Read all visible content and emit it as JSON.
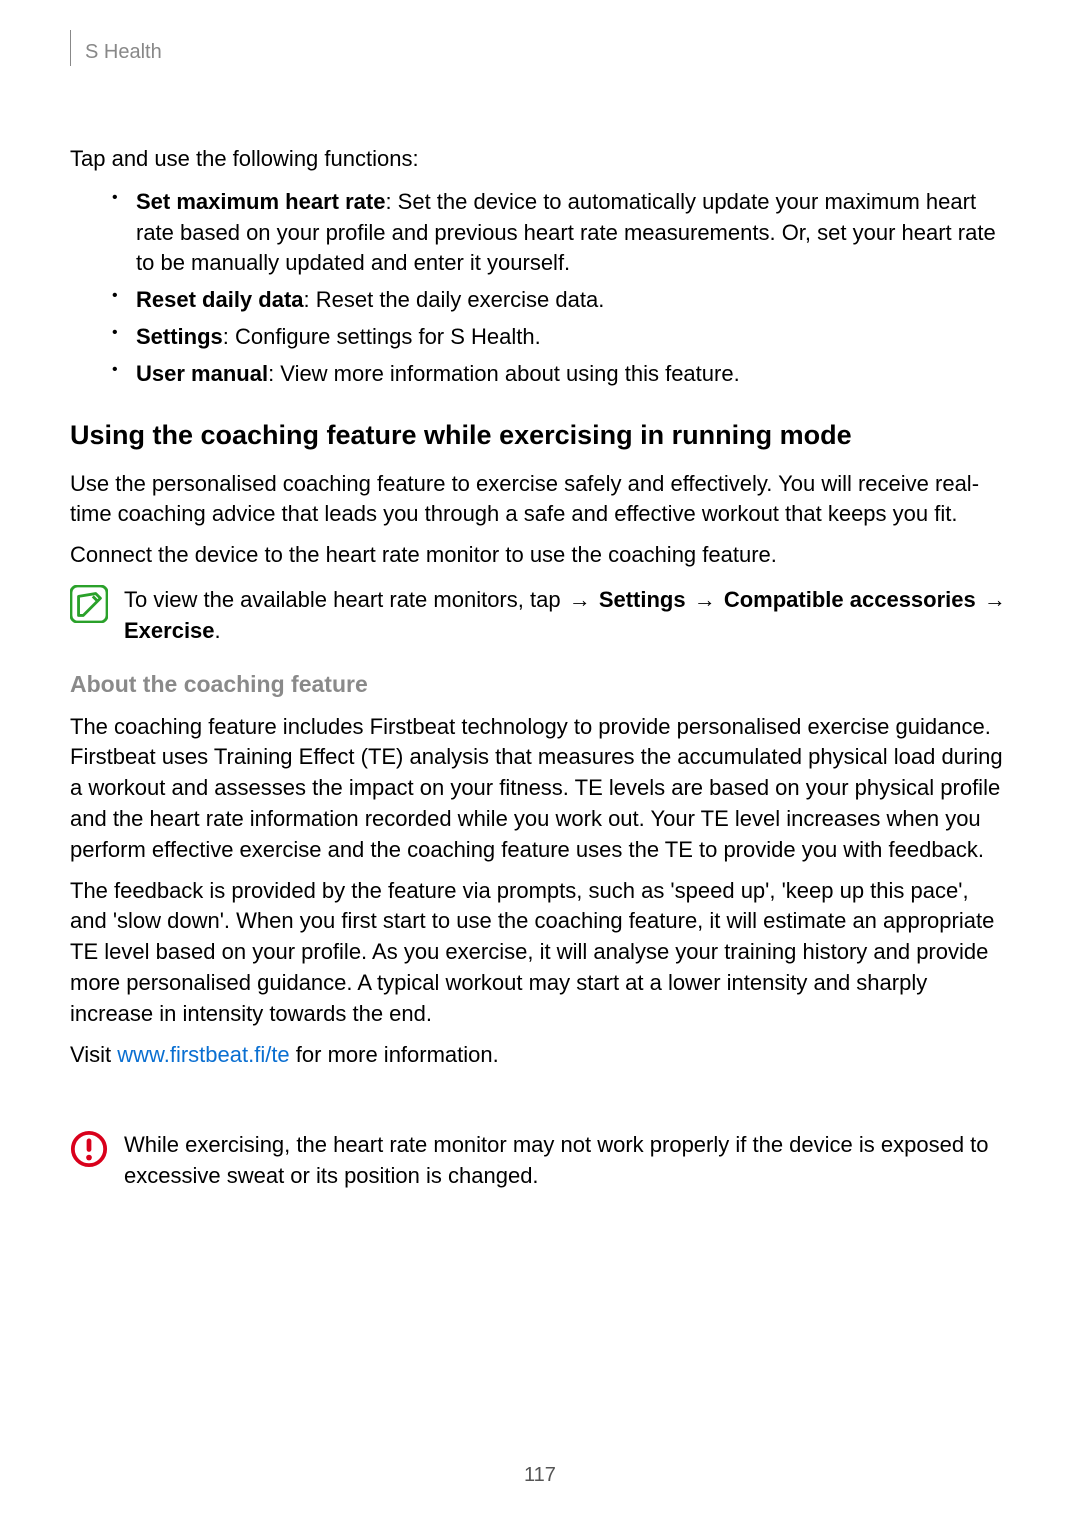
{
  "header": {
    "section": "S Health"
  },
  "intro_line": "Tap   and use the following functions:",
  "func_list": [
    {
      "label": "Set maximum heart rate",
      "desc": ": Set the device to automatically update your maximum heart rate based on your profile and previous heart rate measurements. Or, set your heart rate to be manually updated and enter it yourself."
    },
    {
      "label": "Reset daily data",
      "desc": ": Reset the daily exercise data."
    },
    {
      "label": "Settings",
      "desc": ": Configure settings for S Health."
    },
    {
      "label": "User manual",
      "desc": ": View more information about using this feature."
    }
  ],
  "section_title": "Using the coaching feature while exercising in running mode",
  "para1": "Use the personalised coaching feature to exercise safely and effectively. You will receive real-time coaching advice that leads you through a safe and effective workout that keeps you fit.",
  "para2": "Connect the device to the heart rate monitor to use the coaching feature.",
  "tip": {
    "prefix": "To view the available heart rate monitors, tap   ",
    "arrow": "→",
    "settings": "Settings",
    "compat": "Compatible accessories",
    "exercise": "Exercise",
    "period": "."
  },
  "sub_title": "About the coaching feature",
  "para3": "The coaching feature includes Firstbeat technology to provide personalised exercise guidance. Firstbeat uses Training Effect (TE) analysis that measures the accumulated physical load during a workout and assesses the impact on your fitness. TE levels are based on your physical profile and the heart rate information recorded while you work out. Your TE level increases when you perform effective exercise and the coaching feature uses the TE to provide you with feedback.",
  "para4": "The feedback is provided by the feature via prompts, such as 'speed up', 'keep up this pace', and 'slow down'. When you first start to use the coaching feature, it will estimate an appropriate TE level based on your profile. As you exercise, it will analyse your training history and provide more personalised guidance. A typical workout may start at a lower intensity and sharply increase in intensity towards the end.",
  "visit": {
    "prefix": "Visit ",
    "link": "www.firstbeat.fi/te",
    "suffix": " for more information."
  },
  "warn_text": "While exercising, the heart rate monitor may not work properly if the device is exposed to excessive sweat or its position is changed.",
  "page_number": "117"
}
